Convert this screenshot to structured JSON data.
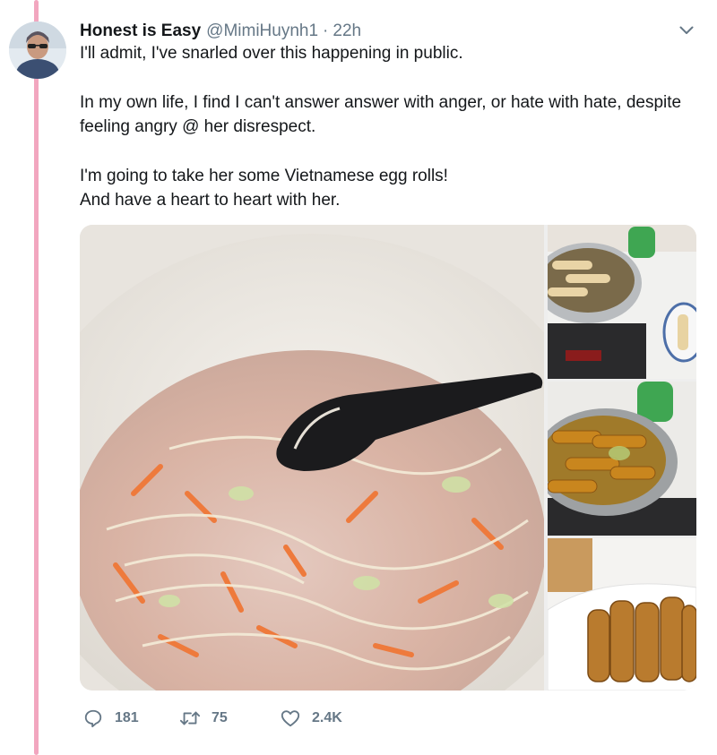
{
  "tweet": {
    "display_name": "Honest is Easy",
    "handle": "@MimiHuynh1",
    "separator": "·",
    "timestamp": "22h",
    "text": {
      "line1": "I'll admit, I've snarled over this happening in public.",
      "para2": "In my own life, I find I can't answer answer with anger, or hate with hate, despite feeling angry @ her disrespect.",
      "line3": "I'm going to take her some Vietnamese egg rolls!",
      "line4": "And have a heart to heart with her."
    },
    "media": [
      {
        "subject": "bowl of egg roll filling with glass noodles, carrot and cabbage, black spoon"
      },
      {
        "subject": "pot of egg rolls on induction cooker"
      },
      {
        "subject": "egg rolls frying in oil"
      },
      {
        "subject": "plate of fried egg rolls"
      }
    ]
  },
  "actions": {
    "reply": {
      "icon": "reply-icon",
      "count": "181"
    },
    "retweet": {
      "icon": "retweet-icon",
      "count": "75"
    },
    "like": {
      "icon": "heart-icon",
      "count": "2.4K"
    }
  },
  "colors": {
    "thread_line": "#f2a6bf",
    "secondary_text": "#657786",
    "primary_text": "#14171a"
  }
}
